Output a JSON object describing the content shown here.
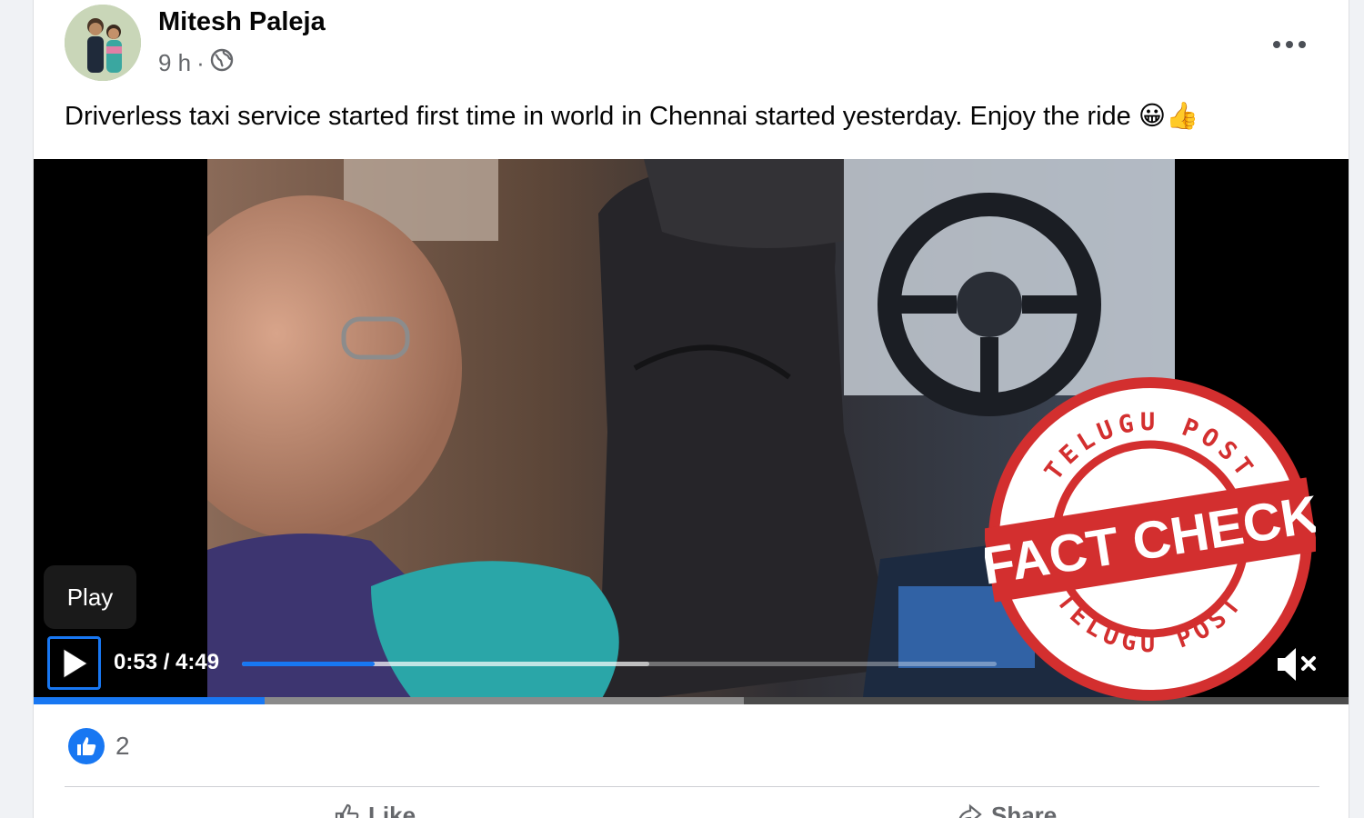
{
  "post": {
    "author": "Mitesh Paleja",
    "time": "9 h",
    "separator": "·",
    "privacy_icon": "globe-icon",
    "more_icon": "ellipsis-icon",
    "text": "Driverless taxi service started first time in world in Chennai started yesterday. Enjoy the ride 😀👍"
  },
  "video": {
    "tooltip": "Play",
    "time_display": "0:53 / 4:49",
    "progress": 0.176,
    "buffered": 0.54,
    "muted": true,
    "play_icon": "play-icon",
    "volume_icon": "volume-muted-icon"
  },
  "watermark": {
    "top_text": "TELUGU POST",
    "center_text": "FACT CHECK",
    "bottom_text": "TELUGU POST",
    "color": "#d32f2f"
  },
  "reactions": {
    "icon": "like-icon",
    "count": "2"
  },
  "actions": {
    "like": "Like",
    "share": "Share"
  },
  "colors": {
    "accent": "#1877f2",
    "text": "#050505",
    "muted": "#65676b"
  }
}
